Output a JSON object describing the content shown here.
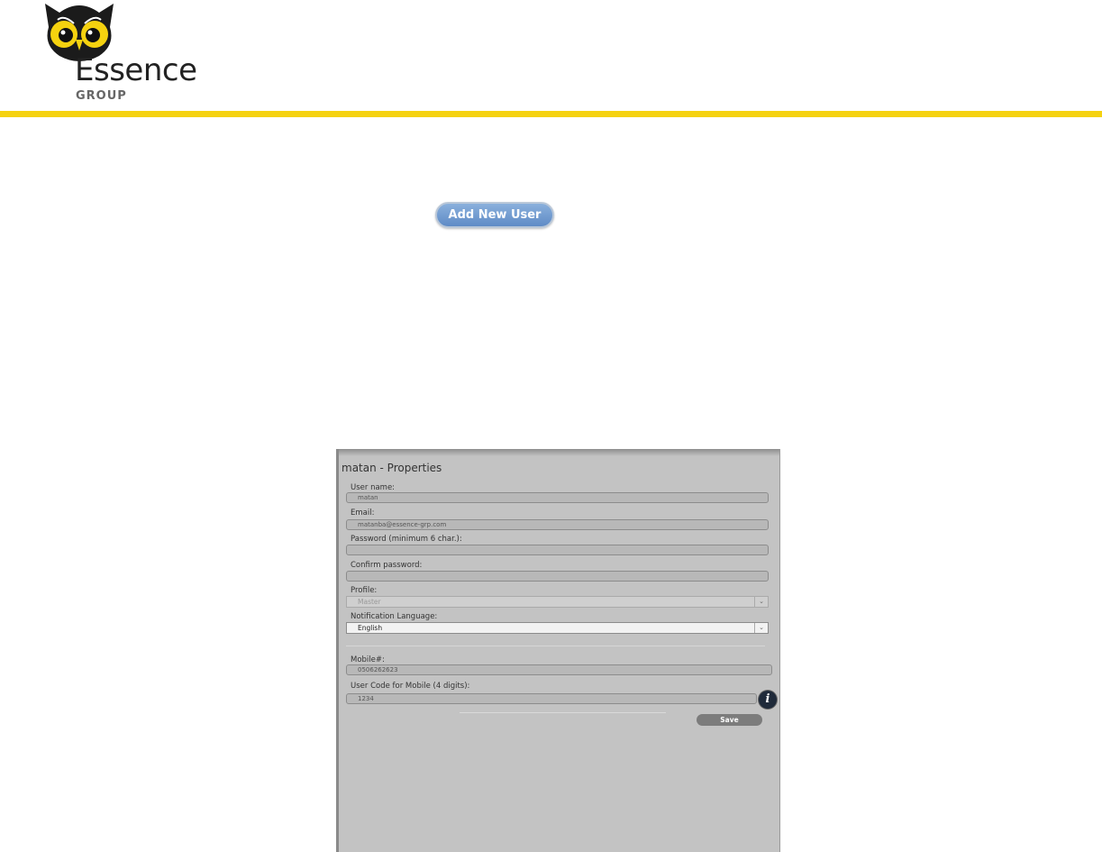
{
  "header": {
    "logo_text": "Essence",
    "logo_subtext": "GROUP",
    "accent_color": "#f5d20f"
  },
  "toolbar": {
    "add_user_label": "Add New User"
  },
  "dialog": {
    "title": "matan - Properties",
    "username_label": "User name:",
    "username_value": "matan",
    "email_label": "Email:",
    "email_value": "matanba@essence-grp.com",
    "password_label": "Password (minimum 6 char.):",
    "password_value": "",
    "confirm_label": "Confirm password:",
    "confirm_value": "",
    "profile_label": "Profile:",
    "profile_value": "Master",
    "language_label": "Notification Language:",
    "language_value": "English",
    "mobile_label": "Mobile#:",
    "mobile_value": "0506262623",
    "usercode_label": "User Code for Mobile (4 digits):",
    "usercode_value": "1234",
    "info_glyph": "i",
    "save_label": "Save"
  }
}
